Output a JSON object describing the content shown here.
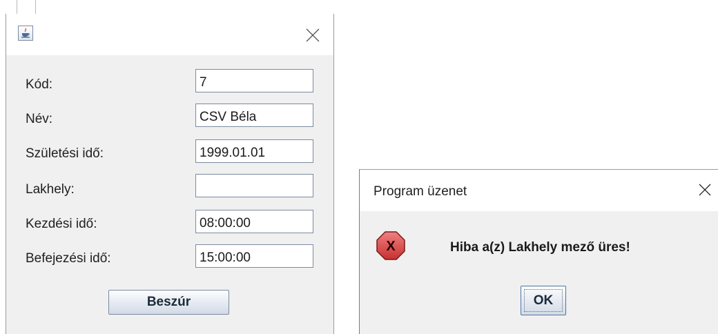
{
  "form_window": {
    "title": "",
    "icon": "java-cup-icon",
    "close_icon": "close-icon",
    "fields": [
      {
        "label": "Kód:",
        "value": "7"
      },
      {
        "label": "Név:",
        "value": "CSV Béla"
      },
      {
        "label": "Születési idő:",
        "value": "1999.01.01"
      },
      {
        "label": "Lakhely:",
        "value": ""
      },
      {
        "label": "Kezdési idő:",
        "value": "08:00:00"
      },
      {
        "label": "Befejezési idő:",
        "value": "15:00:00"
      }
    ],
    "insert_button_label": "Beszúr"
  },
  "message_dialog": {
    "title": "Program üzenet",
    "close_icon": "close-icon",
    "icon": "error-icon",
    "icon_glyph": "X",
    "message": "Hiba a(z) Lakhely mező üres!",
    "ok_label": "OK"
  },
  "colors": {
    "error_icon_fill": "#e04848",
    "dialog_bg": "#f0f0f0",
    "titlebar_bg": "#ffffff"
  }
}
